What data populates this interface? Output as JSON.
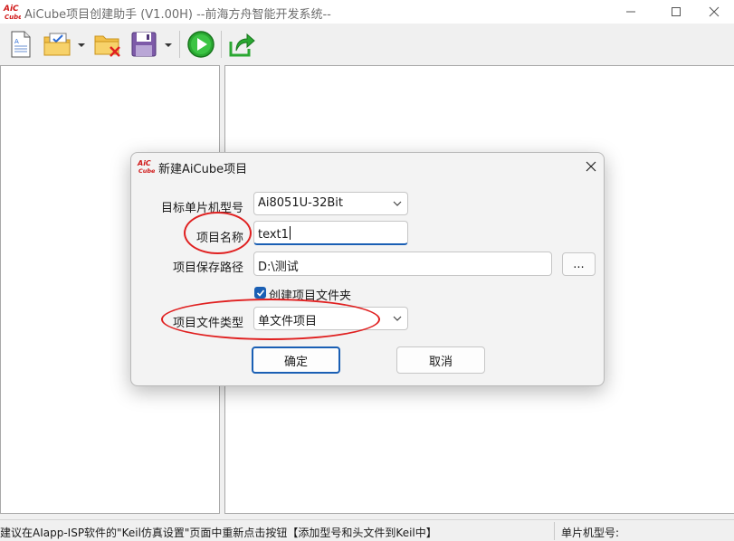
{
  "window": {
    "title": "AiCube项目创建助手 (V1.00H) --前海方舟智能开发系统--",
    "logo_top": "AiC",
    "logo_bottom": "Cube"
  },
  "toolbar": {
    "icons": [
      "new-document-icon",
      "open-folder-icon",
      "close-project-icon",
      "save-icon",
      "run-icon",
      "export-icon"
    ]
  },
  "dialog": {
    "title": "新建AiCube项目",
    "mcu_label": "目标单片机型号",
    "mcu_value": "Ai8051U-32Bit",
    "name_label": "项目名称",
    "name_value": "text1",
    "path_label": "项目保存路径",
    "path_value": "D:\\测试",
    "browse_label": "...",
    "create_folder_label": "创建项目文件夹",
    "create_folder_checked": true,
    "type_label": "项目文件类型",
    "type_value": "单文件项目",
    "ok_label": "确定",
    "cancel_label": "取消"
  },
  "statusbar": {
    "message": "建议在AIapp-ISP软件的\"Keil仿真设置\"页面中重新点击按钮【添加型号和头文件到Keil中】",
    "mcu_label": "单片机型号:"
  },
  "colors": {
    "accent": "#1a5fb4",
    "annotation": "#e02020"
  }
}
